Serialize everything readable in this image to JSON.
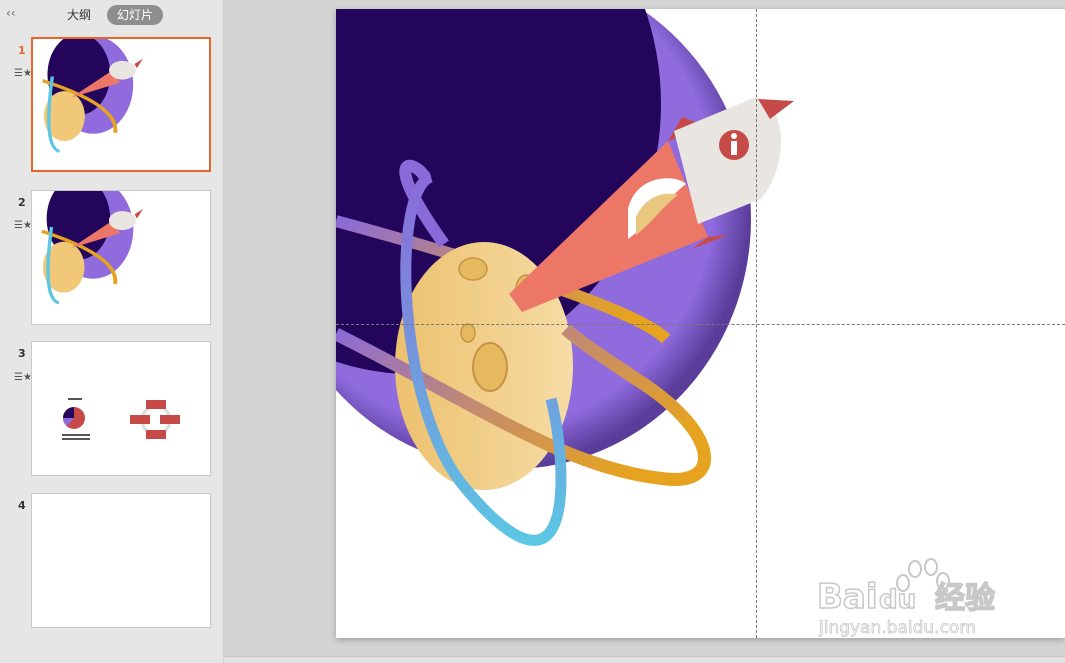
{
  "sidebar": {
    "collapse_icon": "double-chevron-left-icon",
    "tabs": [
      {
        "label": "大纲",
        "active": false
      },
      {
        "label": "幻灯片",
        "active": true
      }
    ],
    "slides": [
      {
        "number": "1",
        "selected": true,
        "has_animation": true
      },
      {
        "number": "2",
        "selected": false,
        "has_animation": true
      },
      {
        "number": "3",
        "selected": false,
        "has_animation": true
      },
      {
        "number": "4",
        "selected": false,
        "has_animation": false
      }
    ]
  },
  "watermark": {
    "brand_latin": "Bai",
    "brand_du": "du",
    "brand_cn": "经验",
    "url": "jingyan.baidu.com"
  },
  "colors": {
    "accent": "#e8652c",
    "space_dark": "#23055c",
    "space_purple": "#8f6bde",
    "moon": "#f0c877",
    "rocket_body": "#ec7766",
    "rocket_nose": "#e9e5e1",
    "rocket_red": "#c64a48",
    "ring_orange": "#e5a320",
    "ring_blue": "#5cc6e3"
  }
}
